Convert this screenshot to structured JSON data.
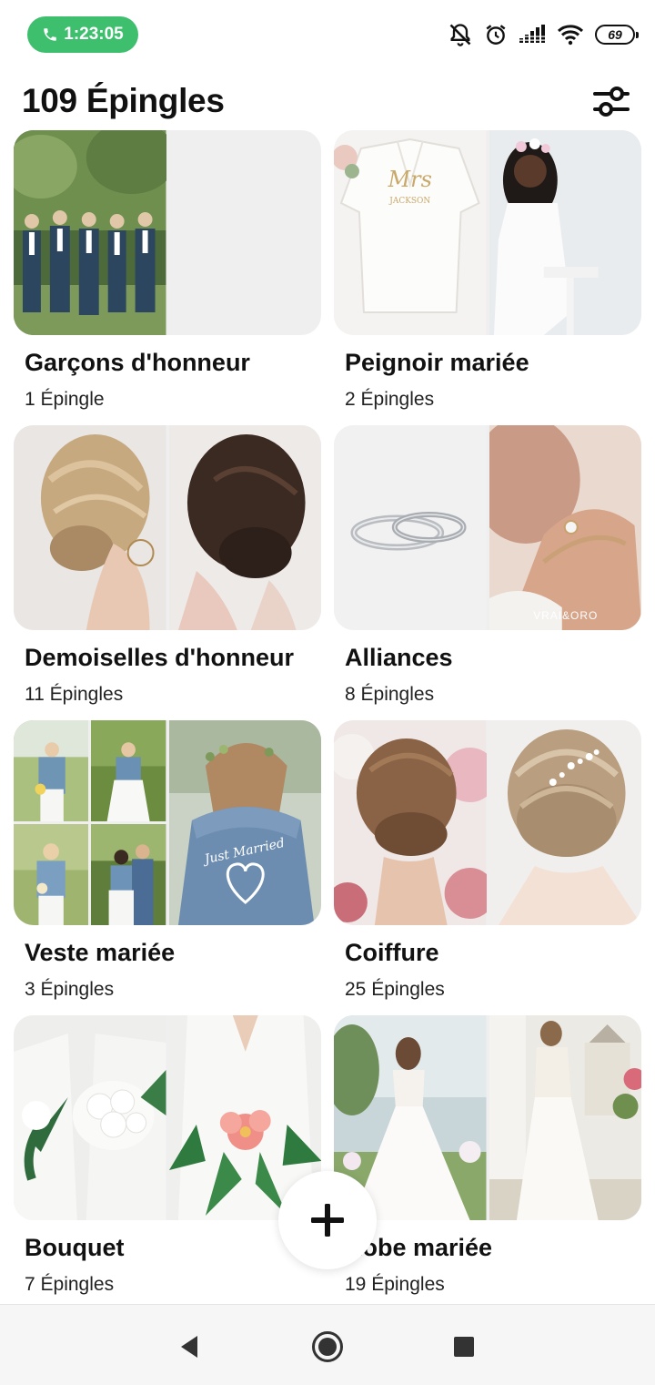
{
  "status_bar": {
    "call_timer": "1:23:05",
    "battery_level": "69",
    "icons": [
      "phone-icon",
      "mute-icon",
      "alarm-icon",
      "signal-icon",
      "wifi-icon",
      "battery-icon"
    ]
  },
  "header": {
    "title": "109 Épingles",
    "filter_icon": "sliders-icon"
  },
  "boards": [
    {
      "name": "Garçons d'honneur",
      "count": "1 Épingle"
    },
    {
      "name": "Peignoir mariée",
      "count": "2 Épingles"
    },
    {
      "name": "Demoiselles d'honneur",
      "count": "11 Épingles"
    },
    {
      "name": "Alliances",
      "count": "8 Épingles"
    },
    {
      "name": "Veste mariée",
      "count": "3 Épingles"
    },
    {
      "name": "Coiffure",
      "count": "25 Épingles"
    },
    {
      "name": "Bouquet",
      "count": "7 Épingles"
    },
    {
      "name": "Robe mariée",
      "count": "19 Épingles"
    }
  ],
  "image_text": {
    "robe_print": "Mrs",
    "robe_name": "JACKSON",
    "watermark": "VRAI&ORO",
    "jacket_text": "Just Married"
  },
  "fab": {
    "icon": "plus-icon"
  },
  "nav_bar": {
    "icons": [
      "back-icon",
      "home-icon",
      "recents-icon"
    ]
  }
}
